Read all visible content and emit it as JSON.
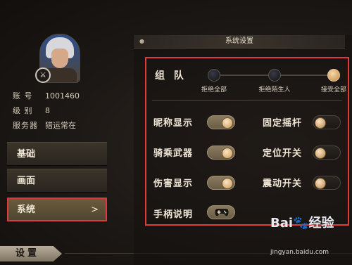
{
  "profile": {
    "rows": [
      {
        "label": "账 号",
        "value": "1001460"
      },
      {
        "label": "级 别",
        "value": "8"
      },
      {
        "label": "服务器",
        "value": "猎运常在"
      }
    ]
  },
  "menu": {
    "items": [
      {
        "label": "基础"
      },
      {
        "label": "画面"
      },
      {
        "label": "系统",
        "chevron": ">"
      }
    ],
    "selected": "系统"
  },
  "footer": {
    "title": "设置"
  },
  "settings": {
    "title": "系统设置",
    "team": {
      "label": "组 队",
      "options": [
        {
          "label": "拒绝全部",
          "selected": false
        },
        {
          "label": "拒绝陌生人",
          "selected": false
        },
        {
          "label": "接受全部",
          "selected": true
        }
      ]
    },
    "toggles": [
      {
        "label": "昵称显示",
        "on": true
      },
      {
        "label": "固定摇杆",
        "on": false
      },
      {
        "label": "骑乘武器",
        "on": true
      },
      {
        "label": "定位开关",
        "on": false
      },
      {
        "label": "伤害显示",
        "on": true
      },
      {
        "label": "震动开关",
        "on": false
      }
    ],
    "gamepad_label": "手柄说明"
  },
  "watermark": {
    "brand_a": "Bai",
    "brand_b": "经验",
    "url": "jingyan.baidu.com"
  },
  "colors": {
    "highlight_border": "#e23a3a",
    "toggle_on": "#7a6b52",
    "knob": "#e8c08a"
  }
}
